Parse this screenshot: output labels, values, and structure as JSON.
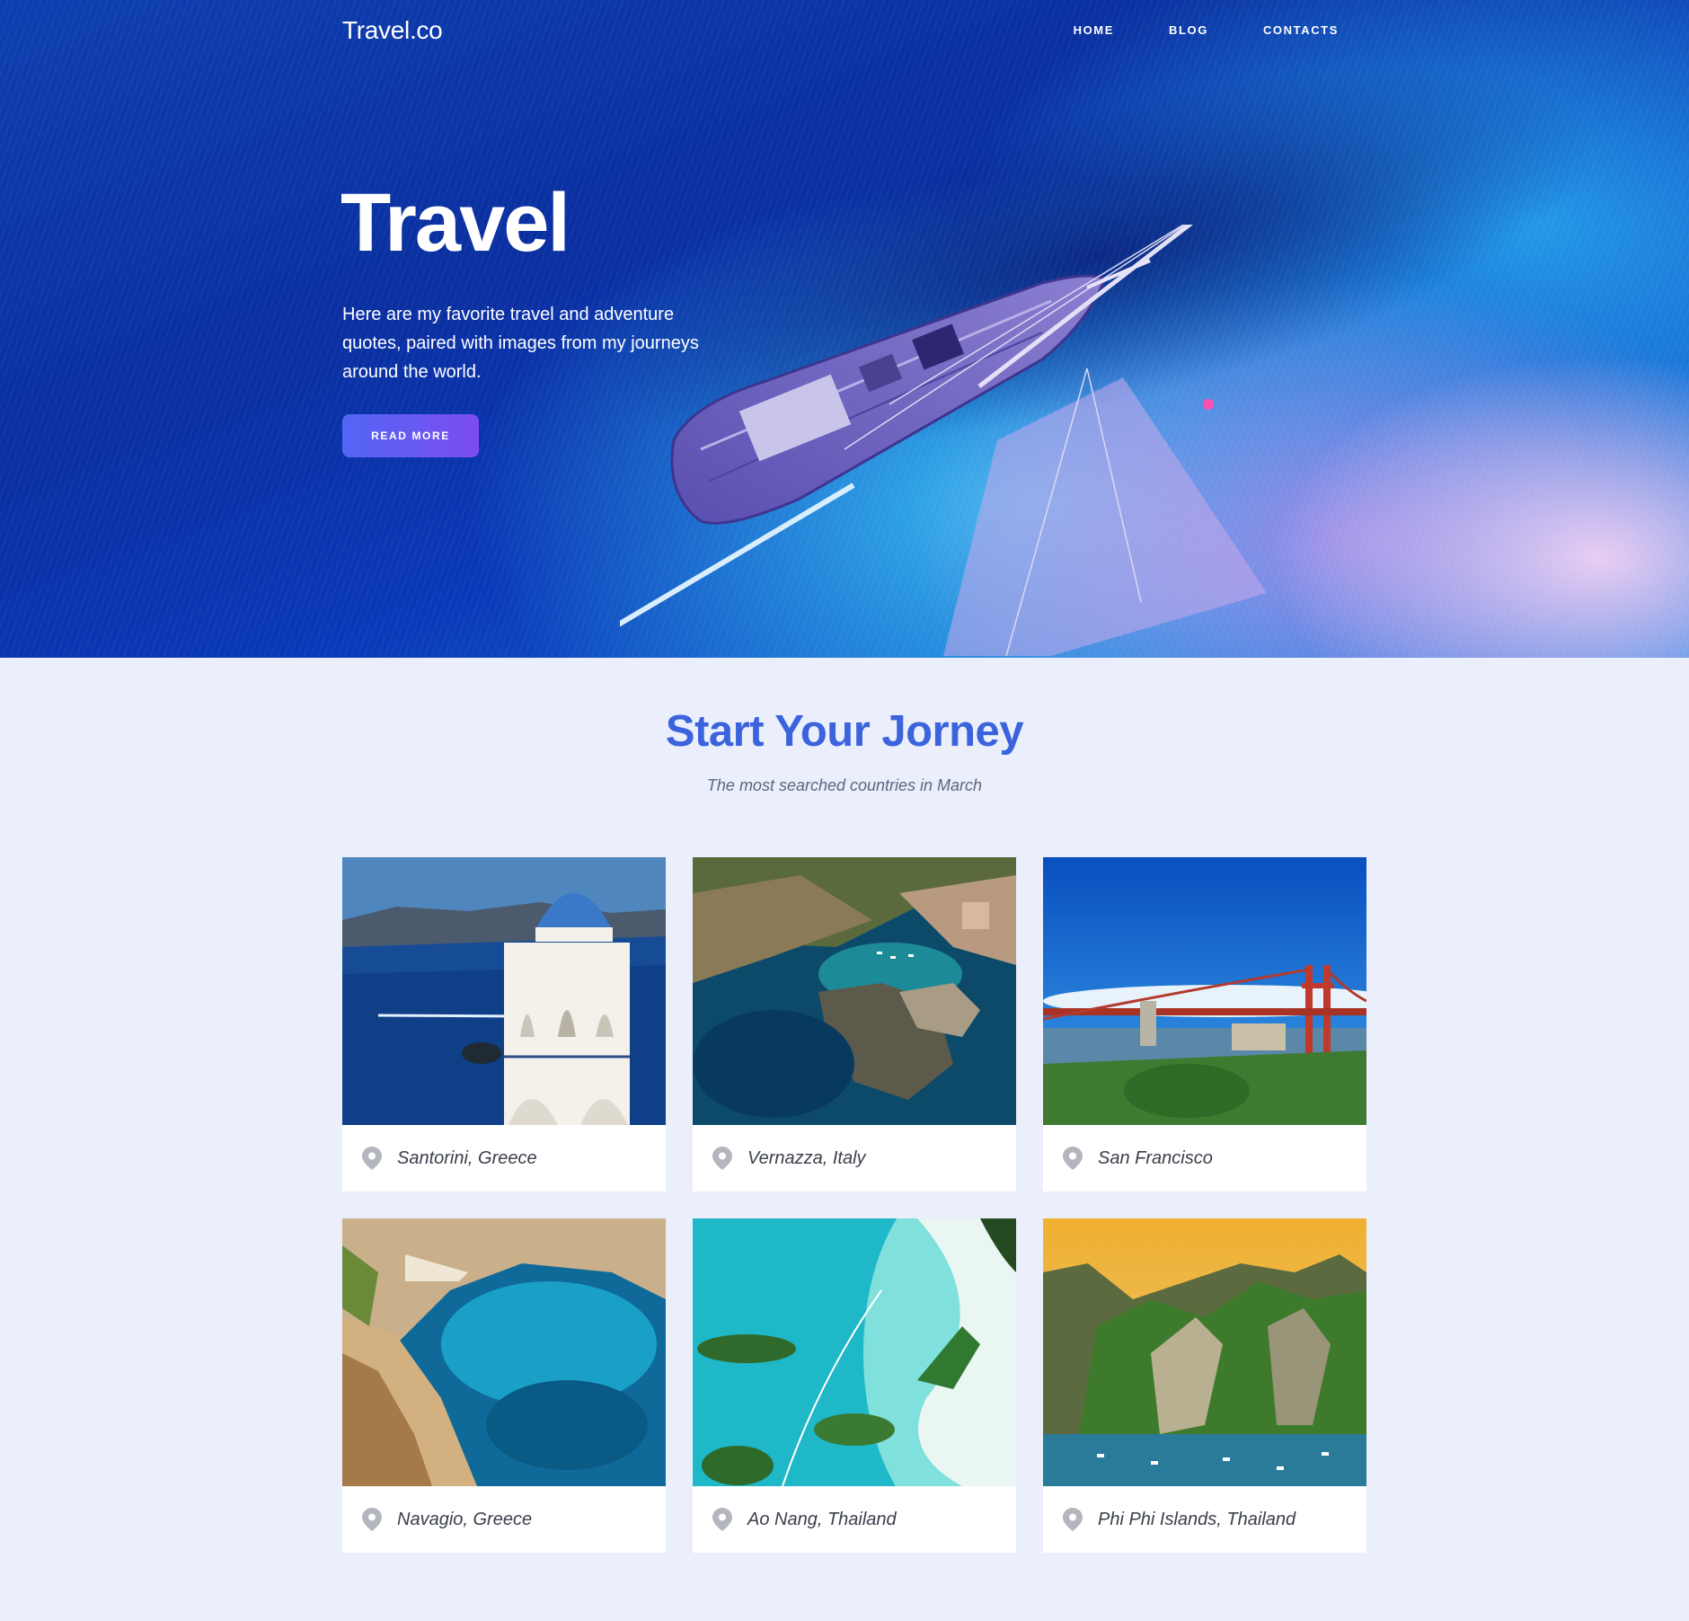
{
  "header": {
    "brand": "Travel.co",
    "nav": [
      "HOME",
      "BLOG",
      "CONTACTS"
    ]
  },
  "hero": {
    "title": "Travel",
    "description": "Here are my favorite travel and adventure quotes, paired with images from my journeys around the world.",
    "button_label": "READ MORE"
  },
  "section": {
    "title": "Start Your Jorney",
    "subtitle": "The most searched countries in March"
  },
  "destinations": [
    {
      "name": "Santorini, Greece",
      "icon": "location-pin-icon"
    },
    {
      "name": "Vernazza, Italy",
      "icon": "location-pin-icon"
    },
    {
      "name": "San Francisco",
      "icon": "location-pin-icon"
    },
    {
      "name": "Navagio, Greece",
      "icon": "location-pin-icon"
    },
    {
      "name": "Ao Nang, Thailand",
      "icon": "location-pin-icon"
    },
    {
      "name": "Phi Phi Islands, Thailand",
      "icon": "location-pin-icon"
    }
  ],
  "colors": {
    "accent": "#3b63dc",
    "button_gradient_start": "#5366f5",
    "button_gradient_end": "#7c4cf0",
    "page_background": "#ebeffb"
  }
}
